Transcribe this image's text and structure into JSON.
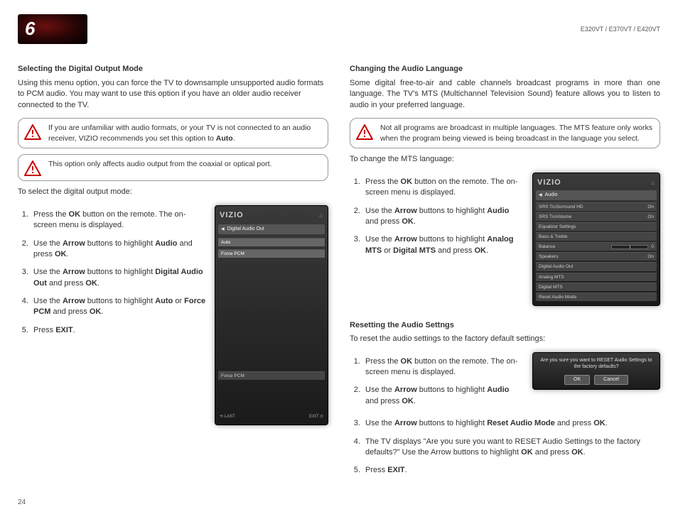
{
  "header": {
    "chapter": "6",
    "models": "E320VT / E370VT / E420VT"
  },
  "left": {
    "title1": "Selecting the Digital Output Mode",
    "intro1": "Using this menu option, you can force the TV to downsample unsupported audio formats to PCM audio. You may want to use this option if you have an older audio receiver connected to the TV.",
    "note1": "If you are unfamiliar with audio formats, or your TV is not connected to an audio receiver, VIZIO recommends you set this option to ",
    "note1_bold": "Auto",
    "note1_end": ".",
    "note2": "This option only affects audio output from the coaxial or optical port.",
    "lead1": "To select the digital output mode:",
    "s1a": "Press the ",
    "s1b": "OK",
    "s1c": " button on the remote. The on-screen menu is displayed.",
    "s2a": "Use the ",
    "s2b": "Arrow",
    "s2c": " buttons to highlight ",
    "s2d": "Audio",
    "s2e": " and press ",
    "s2f": "OK",
    "s2g": ".",
    "s3a": "Use the ",
    "s3b": "Arrow",
    "s3c": " buttons to highlight ",
    "s3d": "Digital Audio Out",
    "s3e": " and press ",
    "s3f": "OK",
    "s3g": ".",
    "s4a": "Use the ",
    "s4b": "Arrow",
    "s4c": " buttons to highlight ",
    "s4d": "Auto",
    "s4e": " or ",
    "s4f": "Force PCM",
    "s4g": " and press ",
    "s4h": "OK",
    "s4i": ".",
    "s5a": "Press ",
    "s5b": "EXIT",
    "s5c": "."
  },
  "osd1": {
    "logo": "VIZIO",
    "crumb": "Digital Audio Out",
    "opt1": "Auto",
    "opt2": "Force PCM",
    "bottom_item": "Force PCM",
    "last": "LAST",
    "exit": "EXIT"
  },
  "right": {
    "title1": "Changing the Audio Language",
    "intro1": "Some digital free-to-air and cable channels broadcast programs in more than one language. The TV's MTS (Multichannel Television Sound) feature allows you to listen to audio in your preferred language.",
    "note1": "Not all programs are broadcast in multiple languages. The MTS feature only works when the program being viewed is being broadcast in the language you select.",
    "lead1": "To change the MTS language:",
    "s1a": "Press the ",
    "s1b": "OK",
    "s1c": " button on the remote. The on-screen menu is displayed.",
    "s2a": "Use the ",
    "s2b": "Arrow",
    "s2c": " buttons to highlight ",
    "s2d": "Audio",
    "s2e": " and press ",
    "s2f": "OK",
    "s2g": ".",
    "s3a": "Use the ",
    "s3b": "Arrow",
    "s3c": " buttons to highlight ",
    "s3d": "Analog MTS",
    "s3e": " or ",
    "s3f": "Digital MTS",
    "s3g": " and press ",
    "s3h": "OK",
    "s3i": ".",
    "title2": "Resetting the Audio Settngs",
    "lead2": "To reset the audio settings to the factory default settings:",
    "r1a": "Press the ",
    "r1b": "OK",
    "r1c": " button on the remote. The on-screen menu is displayed.",
    "r2a": "Use the ",
    "r2b": "Arrow",
    "r2c": " buttons to highlight ",
    "r2d": "Audio",
    "r2e": " and press ",
    "r2f": "OK",
    "r2g": ".",
    "r3a": "Use the ",
    "r3b": "Arrow",
    "r3c": " buttons to highlight ",
    "r3d": "Reset Audio Mode",
    "r3e": " and press ",
    "r3f": "OK",
    "r3g": ".",
    "r4a": "The TV displays \"Are you sure you want to RESET Audio Settings to the factory defaults?\" Use the Arrow buttons to highlight ",
    "r4b": "OK",
    "r4c": " and press ",
    "r4d": "OK",
    "r4e": ".",
    "r5a": "Press ",
    "r5b": "EXIT",
    "r5c": "."
  },
  "osd2": {
    "logo": "VIZIO",
    "crumb": "Audio",
    "i1": "SRS TruSurround HD",
    "v1": "On",
    "i2": "SRS TruVolume",
    "v2": "On",
    "i3": "Equalizer Settings",
    "i4": "Bass & Treble",
    "i5": "Balance",
    "v5": "0",
    "i6": "Speakers",
    "v6": "On",
    "i7": "Digital Audio Out",
    "i8": "Analog MTS",
    "i9": "Digital MTS",
    "i10": "Reset Audio Mode"
  },
  "osd3": {
    "msg": "Are you sure you want to RESET Audio Settings to the factory defaults?",
    "ok": "OK",
    "cancel": "Cancel"
  },
  "page_num": "24"
}
